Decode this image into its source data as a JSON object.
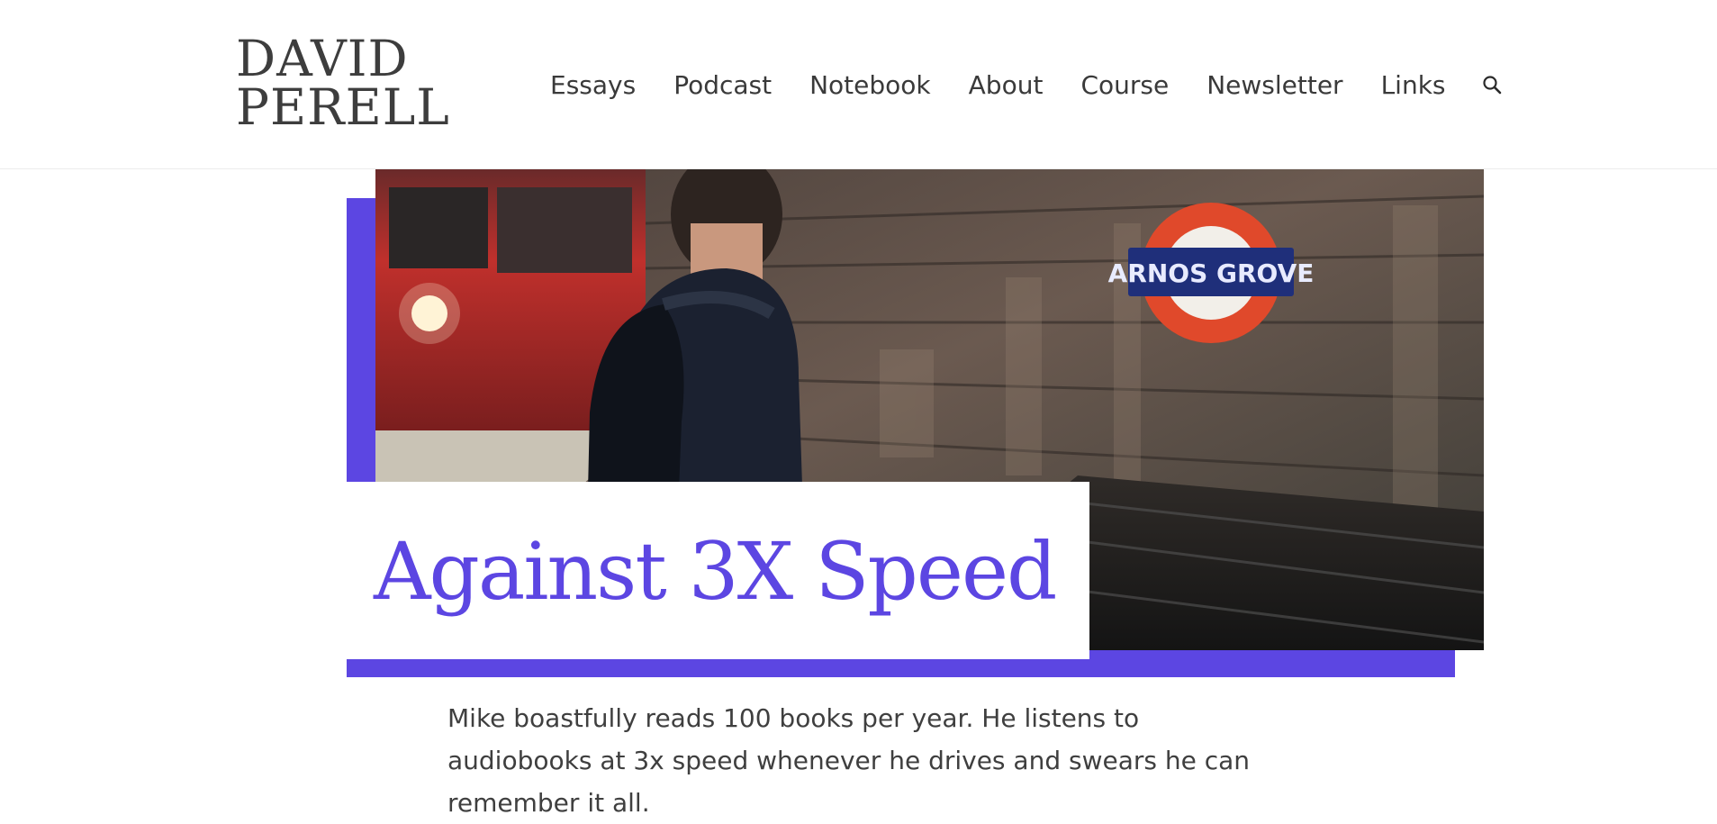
{
  "site": {
    "logo_line1": "DAVID",
    "logo_line2": "PERELL"
  },
  "nav": {
    "items": [
      {
        "label": "Essays"
      },
      {
        "label": "Podcast"
      },
      {
        "label": "Notebook"
      },
      {
        "label": "About"
      },
      {
        "label": "Course"
      },
      {
        "label": "Newsletter"
      },
      {
        "label": "Links"
      }
    ],
    "search_icon": "search-icon"
  },
  "hero": {
    "sign_text": "ARNOS GROVE",
    "accent_color": "#5c46e2"
  },
  "article": {
    "title": "Against 3X Speed",
    "intro": "Mike boastfully reads 100 books per year. He listens to audiobooks at 3x speed whenever he drives and swears he can remember it all."
  }
}
